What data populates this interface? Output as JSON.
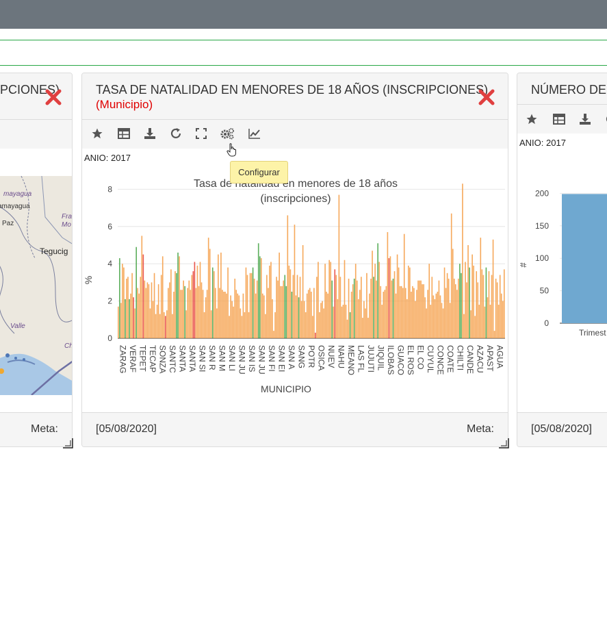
{
  "header": {},
  "left_panel": {
    "title": "CIPCIONES)",
    "footer_meta": "Meta:",
    "map_labels": [
      "mayagua",
      "amayagua",
      "Paz",
      "Fran",
      "Mo",
      "Tegucig",
      "Valle",
      "Ch"
    ]
  },
  "center_panel": {
    "title": "TASA DE NATALIDAD EN MENORES DE 18 AÑOS (INSCRIPCIONES)",
    "subtitle": "(Municipio)",
    "anio": "ANIO: 2017",
    "footer_date": "[05/08/2020]",
    "footer_meta": "Meta:",
    "tooltip": "Configurar",
    "toolbar_icons": [
      "star-icon",
      "table-icon",
      "download-icon",
      "refresh-icon",
      "fullscreen-icon",
      "gears-icon",
      "line-chart-icon"
    ]
  },
  "right_panel": {
    "title": "NÚMERO DE",
    "anio": "ANIO: 2017",
    "footer_date": "[05/08/2020]",
    "toolbar_icons": [
      "star-icon",
      "table-icon",
      "download-icon",
      "refresh-icon"
    ]
  },
  "colors": {
    "orange": "#f5a04a",
    "green": "#4ca64c",
    "red": "#e8453c",
    "blue_bar": "#6fa8d0",
    "close_red": "#e04040"
  },
  "chart_data": [
    {
      "type": "bar",
      "title": "Tasa de natalidad en menores de 18 años (inscripciones)",
      "title_lines": [
        "Tasa de natalidad en menores de 18 años",
        "(inscripciones)"
      ],
      "xlabel": "MUNICIPIO",
      "ylabel": "%",
      "ylim": [
        0,
        8.5
      ],
      "yticks": [
        "0",
        "2",
        "4",
        "6",
        "8"
      ],
      "grid": true,
      "x_tick_labels": [
        "ZARAG",
        "VERAF",
        "TEPET",
        "TECAP",
        "SONZA",
        "SANTC",
        "SANTA",
        "SANTA",
        "SAN SI",
        "SAN R",
        "SAN M",
        "SAN LI",
        "SAN JU",
        "SAN IS",
        "SAN JU",
        "SAN FI",
        "SAN EI",
        "SAN A",
        "SANG",
        "POTR",
        "OSICA",
        "NUEV",
        "NAHU",
        "MEANO",
        "LAS FL",
        "JUJUTI",
        "JIQUIL",
        "ILOBAS",
        "GUACO",
        "EL ROS",
        "EL CO",
        "CUYUL",
        "CONCE",
        "COATE",
        "CHILTI",
        "CANDE",
        "AZACU",
        "APAST",
        "AGUA"
      ],
      "values": [
        1.7,
        4.3,
        1.9,
        4.0,
        3.8,
        2.1,
        3.2,
        3.3,
        2.1,
        2.4,
        3.5,
        2.2,
        1.6,
        4.9,
        2.7,
        2.4,
        3.3,
        5.5,
        4.5,
        3.1,
        2.7,
        3.0,
        2.9,
        1.6,
        3.0,
        2.0,
        3.5,
        1.3,
        1.8,
        2.9,
        1.3,
        3.4,
        4.4,
        1.4,
        1.2,
        1.5,
        2.7,
        3.0,
        3.7,
        1.3,
        2.5,
        3.6,
        3.5,
        4.6,
        4.4,
        2.6,
        2.6,
        3.1,
        2.8,
        1.5,
        2.7,
        3.1,
        2.6,
        3.4,
        3.6,
        4.1,
        2.7,
        3.9,
        2.8,
        4.1,
        3.0,
        2.6,
        1.4,
        2.2,
        2.6,
        5.4,
        4.8,
        1.5,
        3.8,
        3.6,
        2.7,
        1.6,
        4.5,
        2.7,
        4.6,
        2.6,
        2.5,
        2.5,
        2.4,
        3.8,
        1.2,
        2.3,
        2.0,
        1.7,
        3.2,
        2.6,
        2.4,
        2.3,
        1.6,
        1.2,
        2.4,
        1.4,
        3.8,
        3.4,
        1.4,
        3.5,
        3.5,
        3.8,
        3.2,
        2.4,
        3.1,
        5.1,
        4.4,
        4.3,
        2.4,
        2.3,
        1.3,
        3.4,
        2.7,
        3.9,
        4.1,
        2.1,
        0.4,
        1.4,
        3.3,
        3.1,
        4.6,
        2.8,
        2.8,
        3.1,
        3.4,
        2.8,
        6.6,
        3.9,
        3.7,
        2.5,
        3.4,
        6.1,
        2.3,
        3.4,
        2.2,
        3.3,
        2.0,
        5.0,
        2.0,
        1.4,
        2.4,
        2.6,
        2.7,
        2.5,
        1.2,
        2.7,
        0.3,
        3.3,
        4.1,
        1.4,
        1.9,
        2.0,
        1.6,
        4.0,
        2.5,
        2.4,
        4.2,
        4.1,
        3.1,
        1.7,
        3.7,
        3.4,
        2.1,
        7.7,
        3.3,
        1.7,
        1.8,
        4.2,
        1.8,
        1.0,
        3.2,
        1.4,
        2.5,
        2.9,
        3.2,
        4.0,
        3.1,
        2.1,
        2.6,
        3.3,
        1.1,
        2.0,
        1.6,
        3.5,
        1.1,
        2.4,
        3.2,
        4.7,
        3.3,
        4.0,
        3.1,
        5.1,
        4.1,
        2.8,
        1.8,
        2.5,
        2.6,
        2.8,
        5.7,
        4.3,
        4.4,
        3.1,
        3.2,
        3.6,
        2.4,
        4.5,
        3.8,
        2.8,
        2.8,
        2.7,
        5.6,
        2.7,
        2.1,
        3.9,
        3.8,
        2.5,
        2.8,
        2.7,
        2.0,
        2.6,
        3.1,
        3.1,
        3.1,
        2.9,
        2.9,
        2.2,
        1.6,
        2.6,
        4.0,
        1.8,
        3.3,
        2.3,
        2.1,
        2.4,
        2.5,
        3.1,
        2.3,
        1.9,
        1.6,
        3.8,
        2.7,
        3.5,
        3.2,
        1.9,
        6.7,
        4.8,
        3.2,
        2.9,
        2.6,
        3.2,
        4.0,
        3.5,
        8.3,
        1.3,
        4.1,
        3.0,
        5.0,
        3.8,
        1.5,
        4.5,
        3.9,
        1.2,
        3.6,
        3.0,
        1.8,
        5.4,
        3.7,
        3.4,
        1.7,
        3.8,
        2.2,
        3.6,
        1.8,
        3.4,
        5.3,
        0.4,
        3.2,
        3.0,
        1.8,
        3.4,
        2.4,
        2.0,
        3.7
      ],
      "colors": [
        "o",
        "g",
        "o",
        "o",
        "o",
        "g",
        "o",
        "o",
        "g",
        "o",
        "o",
        "r",
        "o",
        "g",
        "o",
        "o",
        "o",
        "o",
        "r",
        "o",
        "o",
        "o",
        "o",
        "o",
        "o",
        "o",
        "o",
        "o",
        "o",
        "o",
        "o",
        "o",
        "o",
        "o",
        "r",
        "o",
        "o",
        "o",
        "o",
        "o",
        "o",
        "o",
        "g",
        "g",
        "o",
        "o",
        "o",
        "o",
        "g",
        "o",
        "o",
        "o",
        "o",
        "o",
        "r",
        "r",
        "o",
        "o",
        "o",
        "o",
        "o",
        "o",
        "o",
        "o",
        "o",
        "o",
        "o",
        "o",
        "g",
        "o",
        "o",
        "o",
        "o",
        "o",
        "o",
        "o",
        "o",
        "o",
        "o",
        "o",
        "o",
        "o",
        "o",
        "o",
        "o",
        "o",
        "o",
        "o",
        "o",
        "o",
        "o",
        "o",
        "o",
        "o",
        "o",
        "o",
        "o",
        "g",
        "o",
        "o",
        "o",
        "g",
        "g",
        "o",
        "o",
        "o",
        "o",
        "o",
        "o",
        "o",
        "o",
        "o",
        "o",
        "o",
        "o",
        "o",
        "o",
        "o",
        "o",
        "o",
        "g",
        "g",
        "o",
        "o",
        "o",
        "g",
        "o",
        "o",
        "o",
        "o",
        "g",
        "o",
        "o",
        "o",
        "o",
        "o",
        "o",
        "o",
        "o",
        "o",
        "o",
        "o",
        "r",
        "o",
        "o",
        "o",
        "o",
        "o",
        "o",
        "o",
        "o",
        "o",
        "o",
        "o",
        "g",
        "o",
        "r",
        "o",
        "o",
        "o",
        "o",
        "o",
        "o",
        "o",
        "o",
        "o",
        "o",
        "g",
        "o",
        "o",
        "g",
        "o",
        "o",
        "o",
        "o",
        "o",
        "o",
        "o",
        "o",
        "o",
        "o",
        "o",
        "o",
        "o",
        "g",
        "o",
        "o",
        "g",
        "o",
        "o",
        "o",
        "o",
        "o",
        "o",
        "o",
        "r",
        "o",
        "o",
        "g",
        "o",
        "o",
        "o",
        "o",
        "o",
        "o",
        "o",
        "o",
        "o",
        "o",
        "o",
        "o",
        "o",
        "o",
        "o",
        "o",
        "o",
        "o",
        "o",
        "o",
        "o",
        "o",
        "o",
        "o",
        "o",
        "o",
        "o",
        "o",
        "o",
        "o",
        "o",
        "o",
        "o",
        "o",
        "o",
        "o",
        "o",
        "o",
        "o",
        "o",
        "o",
        "o",
        "o",
        "o",
        "o",
        "o",
        "o",
        "g",
        "g",
        "o",
        "o",
        "o",
        "o",
        "o",
        "g",
        "o",
        "o",
        "o",
        "o",
        "o",
        "o",
        "o",
        "o",
        "o",
        "o",
        "o",
        "g",
        "o",
        "o",
        "o",
        "o",
        "o",
        "o",
        "o",
        "o",
        "o",
        "o",
        "o",
        "o",
        "o",
        "o",
        "o",
        "r",
        "o",
        "o",
        "o",
        "o",
        "g",
        "o",
        "g",
        "g"
      ]
    },
    {
      "type": "bar",
      "ylabel": "#",
      "ylim": [
        0,
        250
      ],
      "yticks": [
        "0",
        "50",
        "100",
        "150",
        "200",
        "250"
      ],
      "categories": [
        "Trimest"
      ],
      "values": [
        199
      ],
      "data_labels": [
        "199.0"
      ]
    }
  ]
}
